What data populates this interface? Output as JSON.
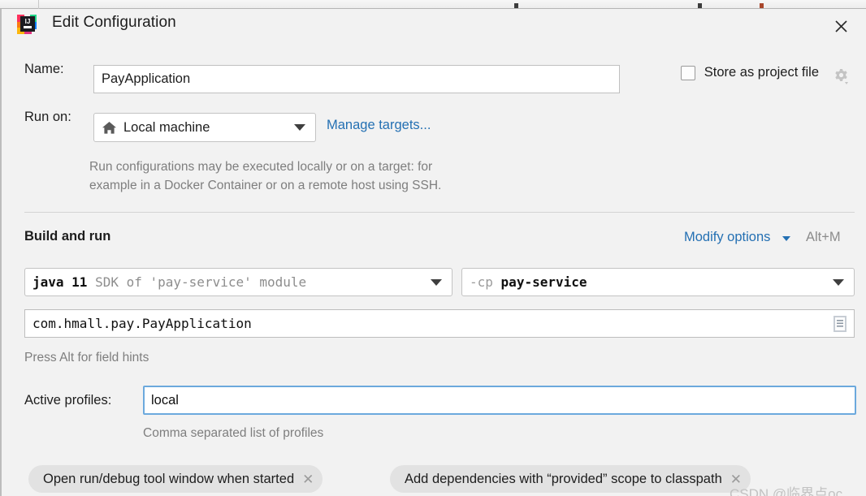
{
  "window": {
    "title": "Edit Configuration",
    "app_icon": "intellij-idea-icon",
    "close_icon": "close-icon"
  },
  "name_row": {
    "label": "Name:",
    "value": "PayApplication",
    "placeholder": ""
  },
  "store_as_project_file": {
    "label": "Store as project file",
    "checked": false,
    "gear_icon": "gear-icon"
  },
  "run_on_row": {
    "label": "Run on:",
    "selected": "Local machine",
    "machine_icon": "home-icon",
    "manage_link": "Manage targets...",
    "description_line1": "Run configurations may be executed locally or on a target: for",
    "description_line2": "example in a Docker Container or on a remote host using SSH."
  },
  "build_and_run": {
    "section_title": "Build and run",
    "modify_options_link": "Modify options",
    "modify_options_shortcut": "Alt+M",
    "sdk_combo": {
      "primary": "java 11",
      "secondary": "SDK of 'pay-service' module"
    },
    "classpath_combo": {
      "prefix": "-cp",
      "module": "pay-service"
    },
    "main_class": {
      "value": "com.hmall.pay.PayApplication",
      "browse_icon": "list-browse-icon"
    },
    "field_hint": "Press Alt for field hints"
  },
  "active_profiles": {
    "label": "Active profiles:",
    "value": "local",
    "hint": "Comma separated list of profiles"
  },
  "option_chips": [
    {
      "label": "Open run/debug tool window when started",
      "remove_icon": "close-icon"
    },
    {
      "label": "Add dependencies with “provided” scope to classpath",
      "remove_icon": "close-icon"
    }
  ],
  "watermark": "CSDN @临界点oc",
  "colors": {
    "dialog_background": "#f2f2f2",
    "field_background": "#ffffff",
    "link_blue": "#2470b3",
    "focus_border": "#6ca9dd",
    "hint_gray": "#7e7e7e",
    "chip_background": "#e2e2e2"
  }
}
